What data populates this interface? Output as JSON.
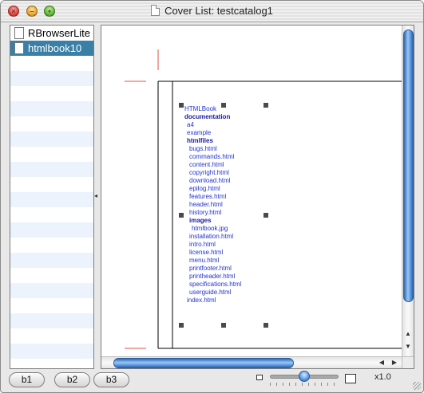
{
  "window": {
    "title": "Cover List: testcatalog1"
  },
  "sidebar": {
    "items": [
      {
        "label": "RBrowserLite",
        "selected": false
      },
      {
        "label": "htmlbook10",
        "selected": true
      }
    ]
  },
  "canvas": {
    "tree": [
      {
        "label": "HTMLBook",
        "bold": false
      },
      {
        "label": "documentation",
        "bold": true
      },
      {
        "label": "a4",
        "bold": false
      },
      {
        "label": "example",
        "bold": false
      },
      {
        "label": "htmlfiles",
        "bold": true
      },
      {
        "label": "bugs.html",
        "bold": false
      },
      {
        "label": "commands.html",
        "bold": false
      },
      {
        "label": "content.html",
        "bold": false
      },
      {
        "label": "copyright.html",
        "bold": false
      },
      {
        "label": "download.html",
        "bold": false
      },
      {
        "label": "epilog.html",
        "bold": false
      },
      {
        "label": "features.html",
        "bold": false
      },
      {
        "label": "header.html",
        "bold": false
      },
      {
        "label": "history.html",
        "bold": false
      },
      {
        "label": "images",
        "bold": true
      },
      {
        "label": "htmlbook.jpg",
        "bold": false
      },
      {
        "label": "installation.html",
        "bold": false
      },
      {
        "label": "intro.html",
        "bold": false
      },
      {
        "label": "license.html",
        "bold": false
      },
      {
        "label": "menu.html",
        "bold": false
      },
      {
        "label": "printfooter.html",
        "bold": false
      },
      {
        "label": "printheader.html",
        "bold": false
      },
      {
        "label": "specifications.html",
        "bold": false
      },
      {
        "label": "userguide.html",
        "bold": false
      },
      {
        "label": "index.html",
        "bold": false
      }
    ]
  },
  "toolbar": {
    "b1": "b1",
    "b2": "b2",
    "b3": "b3",
    "zoom": "x1.0",
    "zoom_level": 0.5
  },
  "colors": {
    "selection": "#3a7fa6",
    "tree_link": "#2233cc",
    "crop_mark": "#e05040",
    "scroll_thumb": "#5f9be0"
  }
}
